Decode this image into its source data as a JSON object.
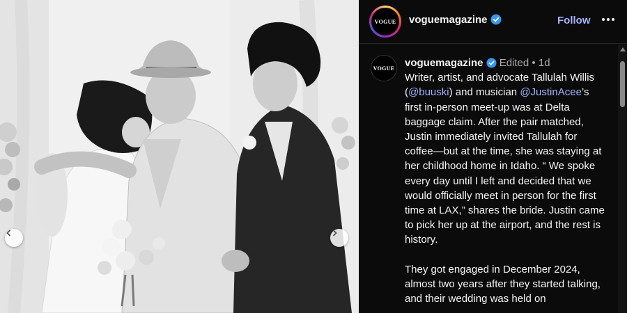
{
  "photo": {
    "alt_note": "",
    "prev_icon": "chevron-left-icon",
    "next_icon": "chevron-right-icon"
  },
  "header": {
    "avatar_logo": "VOGUE",
    "username": "voguemagazine",
    "follow_label": "Follow",
    "more_icon": "more-horizontal-icon",
    "verified_icon": "verified-badge-icon"
  },
  "comment": {
    "avatar_logo": "VOGUE",
    "username": "voguemagazine",
    "edited": "Edited",
    "separator": "•",
    "age": "1d",
    "p1_a": "Writer, artist, and advocate Tallulah Willis (",
    "mention1": "@buuski",
    "p1_b": ") and musician ",
    "mention2": "@JustinAcee",
    "p1_c": "’s first in-person meet-up was at Delta baggage claim. After the pair matched, Justin immediately invited Tallulah for coffee—but at the time, she was staying at her childhood home in Idaho. “ We spoke every day until I left and decided that we would officially meet in person for the first time at LAX,” shares the bride. Justin came to pick her up at the airport, and the rest is history.",
    "p2": "They got engaged in December 2024, almost two years after they started talking, and their wedding was held on"
  },
  "colors": {
    "background": "#0b0b0b",
    "text": "#f5f5f5",
    "link": "#a5b4fc",
    "verified": "#3797f0",
    "muted": "#a8a8a8"
  }
}
